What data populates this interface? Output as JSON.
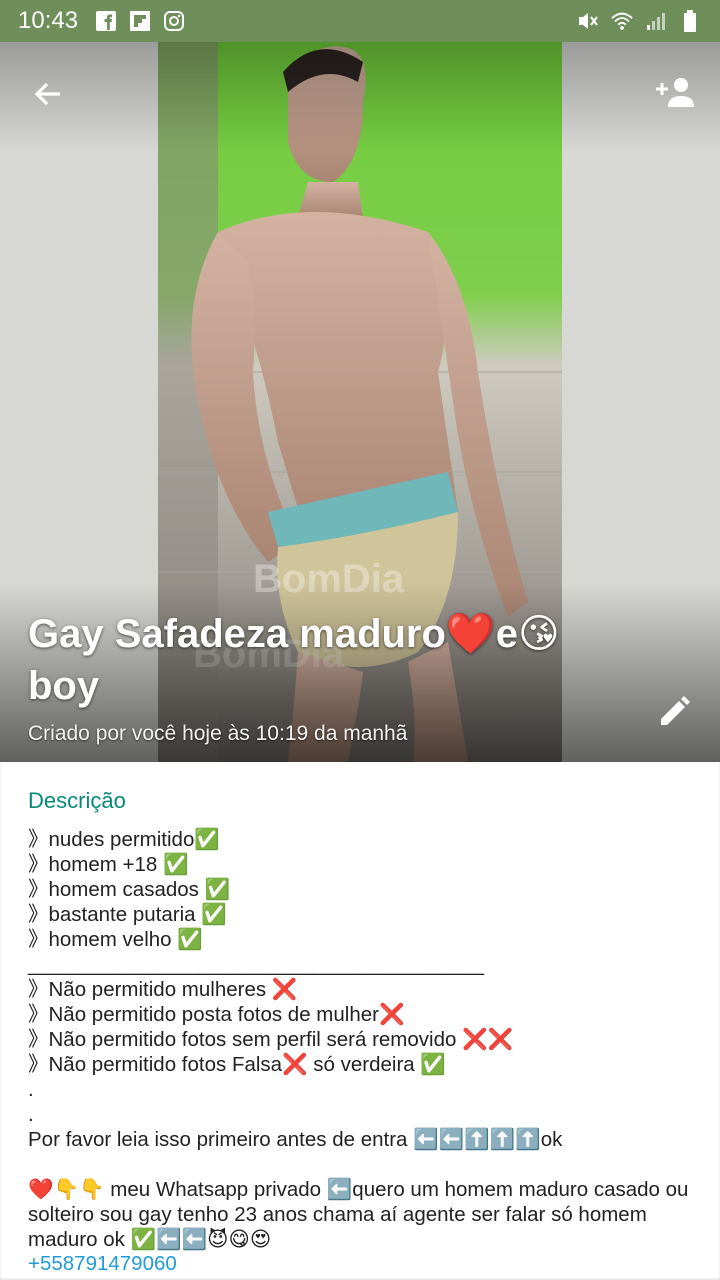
{
  "status_bar": {
    "time": "10:43",
    "left_icons": [
      "facebook-icon",
      "flipboard-icon",
      "instagram-icon"
    ],
    "right_icons": [
      "vibrate-icon",
      "wifi-icon",
      "signal-icon",
      "battery-icon"
    ]
  },
  "header": {
    "title": "Gay Safadeza maduro❤️e😘\nboy",
    "created": "Criado por você hoje às 10:19 da manhã",
    "photo_watermark": "BomDia"
  },
  "description": {
    "label": "Descrição",
    "text": "》nudes permitido✅\n》homem +18 ✅\n》homem casados ✅\n》bastante putaria ✅\n》homem velho ✅\n________________________________________\n》Não permitido mulheres ❌\n》Não permitido posta fotos de mulher❌\n》Não permitido fotos sem perfil será removido ❌❌\n》Não permitido fotos Falsa❌ só verdeira ✅\n.\n.\nPor favor leia isso primeiro antes de entra ⬅️⬅️⬆️⬆️⬆️ok\n\n❤️👇👇 meu Whatsapp privado ⬅️quero um homem maduro casado ou solteiro sou gay tenho 23 anos chama aí agente ser falar só homem maduro ok ✅⬅️⬅️😈😋😍",
    "phone": "+558791479060"
  },
  "colors": {
    "status_bar": "#6e8e5a",
    "accent": "#07897a",
    "link": "#1f9bd8"
  }
}
